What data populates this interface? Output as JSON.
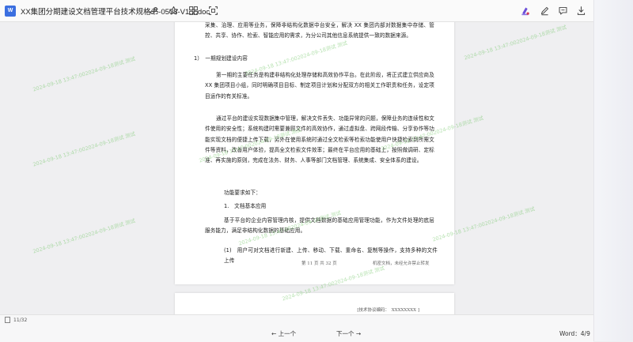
{
  "header": {
    "file_icon_text": "W",
    "title": "XX集团分期建设文档管理平台技术规格书-0508-V1.2.doc",
    "icons": [
      "link-icon",
      "star-icon",
      "grid-icon",
      "scan-icon",
      "color-fill-icon",
      "pen-icon",
      "comment-icon",
      "download-icon"
    ]
  },
  "page1": {
    "paragraphs": [
      "采集、治理、应用等业务，保障非结构化数据中台安全，解决 XX 集团内部对数据集中存储、管控、共享、协作、检索、智能应用的需求，为分公司其他信息系统提供一致的数据来源。",
      "1）　一期规划建设内容",
      "第一期的主要任务是构建非结构化处理存储和高效协作平台。在此阶段，将正式建立供应商及 XX 集团项目小组，同时明确项目目标、制定项目计划和分配双方的相关工作职责和任务，设定项目运作的有关标准。",
      "通过平台的建设实现数据集中管理，解决文件丢失、功能异常的问题，保障业务的连续性和文件使用的安全性；系统构建时需要兼顾文件的高效协作，通过虚拟盘、跨网段传输、分享协作等功能实现文档的便捷上传下载，另外在使用系统时通过全文检索等检索功能使用户快捷检索到所需文件等资料，改善用户体验，提高全文检索文件效率；最终在平台应用的基础上，按照做调研、定标准、再实施的原则，完成在法务、财务、人事等部门文档管理、系统集成、安全体系的建设。",
      "功能要求如下：",
      "1.　文档基本应用",
      "基于平台的企业内容管理内核，提供文档数据的基础应用管理功能，作为文件处理的底层服务能力，满足非结构化数据的基础应用。",
      "(1)　用户可对文档进行新建、上传、移动、下载、重命名、复制等操作，支持多种的文件上传"
    ],
    "footer_page": "第 11 页 共 32 页",
    "footer_note": "机密文档，未经允许禁止转发"
  },
  "page2": {
    "code_line": "[技术协议编码：　XXXXXXXX ]"
  },
  "watermark": "2024-09-18 13:47:002024-09-18测试 测试",
  "bottom": {
    "page_indicator": "11/32",
    "prev": "← 上一个",
    "next": "下一个 →",
    "word_count": "Word：4/9"
  },
  "colors": {
    "accent": "#6b4fd8",
    "watermark": "#7fca6e"
  }
}
